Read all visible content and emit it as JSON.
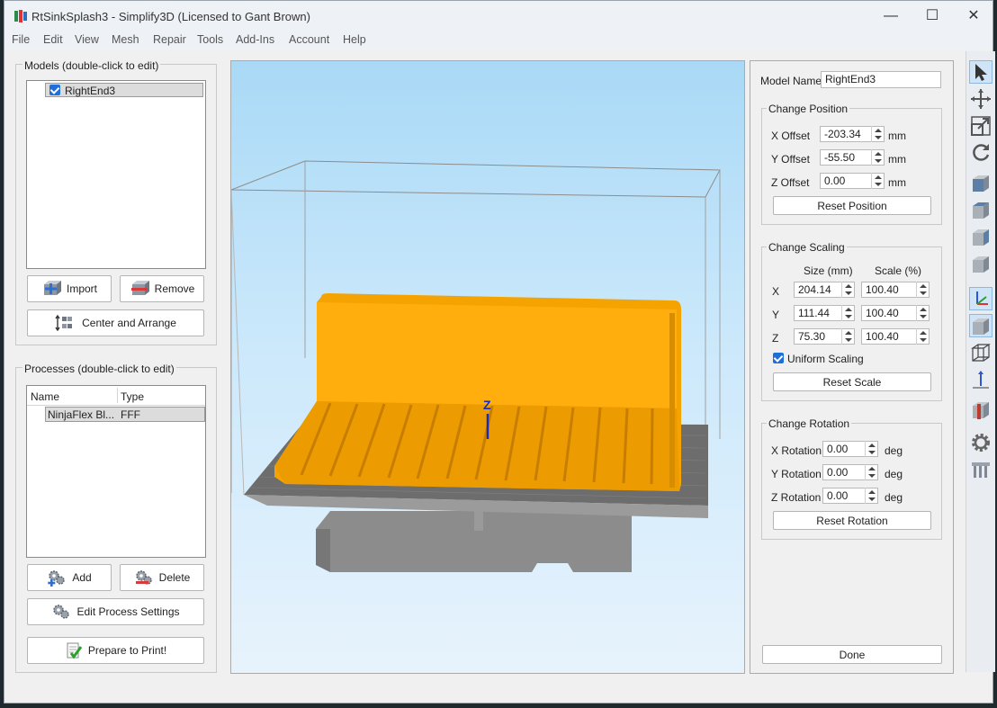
{
  "window": {
    "title": "RtSinkSplash3 - Simplify3D (Licensed to Gant Brown)",
    "minimize_glyph": "—",
    "maximize_glyph": "☐",
    "close_glyph": "✕"
  },
  "menu": [
    "File",
    "Edit",
    "View",
    "Mesh",
    "Repair",
    "Tools",
    "Add-Ins",
    "Account",
    "Help"
  ],
  "models": {
    "title": "Models (double-click to edit)",
    "items": [
      {
        "name": "RightEnd3",
        "checked": true
      }
    ],
    "import_label": "Import",
    "remove_label": "Remove",
    "center_label": "Center and Arrange"
  },
  "processes": {
    "title": "Processes (double-click to edit)",
    "columns": [
      "Name",
      "Type"
    ],
    "rows": [
      {
        "name": "NinjaFlex Bl...",
        "type": "FFF"
      }
    ],
    "add_label": "Add",
    "delete_label": "Delete",
    "edit_label": "Edit Process Settings",
    "prepare_label": "Prepare to Print!"
  },
  "viewport": {
    "axis_label": "Z"
  },
  "model_panel": {
    "name_label": "Model Name:",
    "name_value": "RightEnd3",
    "position": {
      "title": "Change Position",
      "x_label": "X Offset",
      "x_value": "-203.34",
      "y_label": "Y Offset",
      "y_value": "-55.50",
      "z_label": "Z Offset",
      "z_value": "0.00",
      "unit": "mm",
      "reset_label": "Reset Position"
    },
    "scaling": {
      "title": "Change Scaling",
      "size_header": "Size (mm)",
      "scale_header": "Scale (%)",
      "x_label": "X",
      "x_size": "204.14",
      "x_scale": "100.40",
      "y_label": "Y",
      "y_size": "111.44",
      "y_scale": "100.40",
      "z_label": "Z",
      "z_size": "75.30",
      "z_scale": "100.40",
      "uniform_label": "Uniform Scaling",
      "uniform_checked": true,
      "reset_label": "Reset Scale"
    },
    "rotation": {
      "title": "Change Rotation",
      "x_label": "X Rotation",
      "x_value": "0.00",
      "y_label": "Y Rotation",
      "y_value": "0.00",
      "z_label": "Z Rotation",
      "z_value": "0.00",
      "unit": "deg",
      "reset_label": "Reset Rotation"
    },
    "done_label": "Done"
  },
  "colors": {
    "model": "#ffa500",
    "bed": "#8c8c8c",
    "accent": "#1e6fd9"
  },
  "toolbar_icons": [
    "select-arrow-icon",
    "move-icon",
    "scale-icon",
    "rotate-icon",
    "view-cube-front-icon",
    "view-cube-top-icon",
    "view-cube-left-icon",
    "view-cube-right-icon",
    "axes-icon",
    "solid-view-icon",
    "wireframe-view-icon",
    "axis-toggle-icon",
    "cross-section-icon",
    "settings-gear-icon",
    "support-icon"
  ]
}
